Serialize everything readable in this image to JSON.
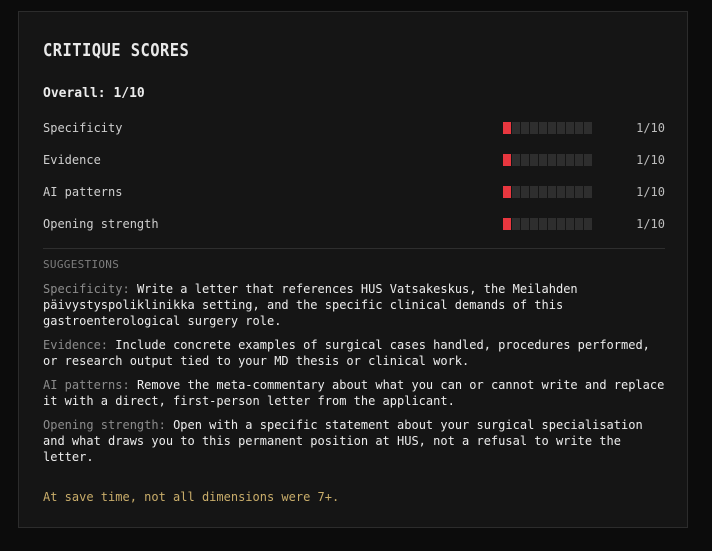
{
  "panel": {
    "title": "CRITIQUE SCORES",
    "overall_label": "Overall:",
    "overall_value": "1/10"
  },
  "scores": [
    {
      "label": "Specificity",
      "score": 1,
      "max": 10,
      "display": "1/10"
    },
    {
      "label": "Evidence",
      "score": 1,
      "max": 10,
      "display": "1/10"
    },
    {
      "label": "AI patterns",
      "score": 1,
      "max": 10,
      "display": "1/10"
    },
    {
      "label": "Opening strength",
      "score": 1,
      "max": 10,
      "display": "1/10"
    }
  ],
  "suggestions": {
    "heading": "SUGGESTIONS",
    "items": [
      {
        "key": "Specificity:",
        "text": "Write a letter that references HUS Vatsakeskus, the Meilahden päivystyspoliklinikka setting, and the specific clinical demands of this gastroenterological surgery role."
      },
      {
        "key": "Evidence:",
        "text": "Include concrete examples of surgical cases handled, procedures performed, or research output tied to your MD thesis or clinical work."
      },
      {
        "key": "AI patterns:",
        "text": "Remove the meta-commentary about what you can or cannot write and replace it with a direct, first-person letter from the applicant."
      },
      {
        "key": "Opening strength:",
        "text": "Open with a specific statement about your surgical specialisation and what draws you to this permanent position at HUS, not a refusal to write the letter."
      }
    ]
  },
  "note": "At save time, not all dimensions were 7+.",
  "colors": {
    "bar_on": "#e8373f",
    "bar_off": "#2e2e2e",
    "note": "#c9ad6a"
  }
}
